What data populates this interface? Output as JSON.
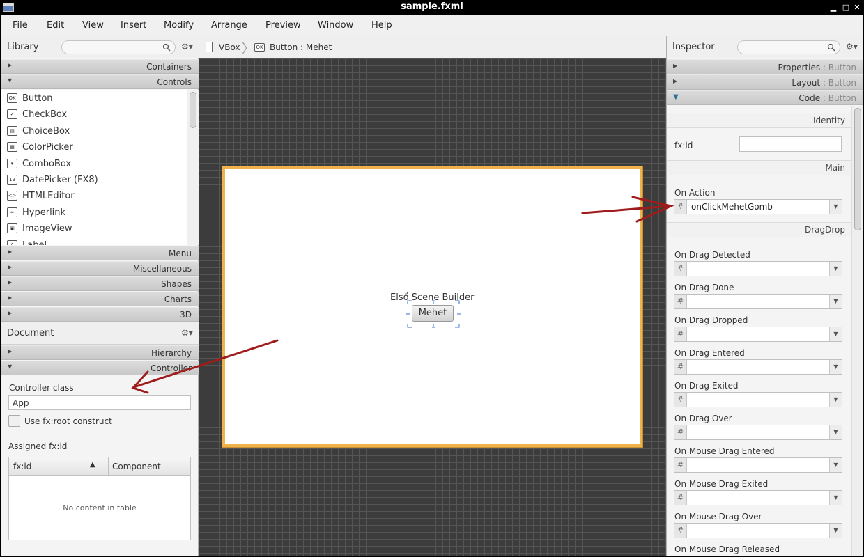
{
  "window": {
    "title": "sample.fxml"
  },
  "menu": [
    "File",
    "Edit",
    "View",
    "Insert",
    "Modify",
    "Arrange",
    "Preview",
    "Window",
    "Help"
  ],
  "library": {
    "title": "Library",
    "sections_top": [
      "Containers",
      "Controls"
    ],
    "controls": [
      {
        "icon": "ok-button-icon",
        "glyph": "OK",
        "label": "Button"
      },
      {
        "icon": "checkbox-icon",
        "glyph": "✓",
        "label": "CheckBox"
      },
      {
        "icon": "choicebox-icon",
        "glyph": "▤",
        "label": "ChoiceBox"
      },
      {
        "icon": "colorpicker-icon",
        "glyph": "▦",
        "label": "ColorPicker"
      },
      {
        "icon": "combobox-icon",
        "glyph": "▾",
        "label": "ComboBox"
      },
      {
        "icon": "datepicker-icon",
        "glyph": "19",
        "label": "DatePicker  (FX8)"
      },
      {
        "icon": "htmleditor-icon",
        "glyph": "<>",
        "label": "HTMLEditor"
      },
      {
        "icon": "hyperlink-icon",
        "glyph": "∞",
        "label": "Hyperlink"
      },
      {
        "icon": "imageview-icon",
        "glyph": "▣",
        "label": "ImageView"
      },
      {
        "icon": "label-icon",
        "glyph": "A",
        "label": "Label"
      }
    ],
    "sections_bottom": [
      "Menu",
      "Miscellaneous",
      "Shapes",
      "Charts",
      "3D"
    ]
  },
  "document": {
    "title": "Document",
    "sections": [
      "Hierarchy",
      "Controller"
    ],
    "controller_class_label": "Controller class",
    "controller_class_value": "App",
    "fxroot_label": "Use fx:root construct",
    "assigned_label": "Assigned fx:id",
    "table": {
      "col1": "fx:id",
      "col2": "Component",
      "empty": "No content in table"
    }
  },
  "breadcrumb": {
    "item1": "VBox",
    "item2": "Button : Mehet"
  },
  "stage": {
    "label_text": "Első Scene Builder",
    "button_text": "Mehet"
  },
  "inspector": {
    "title": "Inspector",
    "sections": [
      {
        "name": "Properties",
        "target": "Button"
      },
      {
        "name": "Layout",
        "target": "Button"
      },
      {
        "name": "Code",
        "target": "Button"
      }
    ],
    "identity_header": "Identity",
    "fxid_label": "fx:id",
    "main_header": "Main",
    "on_action_label": "On Action",
    "on_action_value": "onClickMehetGomb",
    "dragdrop_header": "DragDrop",
    "events": [
      "On Drag Detected",
      "On Drag Done",
      "On Drag Dropped",
      "On Drag Entered",
      "On Drag Exited",
      "On Drag Over",
      "On Mouse Drag Entered",
      "On Mouse Drag Exited",
      "On Mouse Drag Over",
      "On Mouse Drag Released"
    ],
    "hash": "#"
  },
  "colors": {
    "stage_border": "#f0b24a",
    "arrow": "#a01c1c",
    "canvas_bg": "#3c3c3c"
  }
}
